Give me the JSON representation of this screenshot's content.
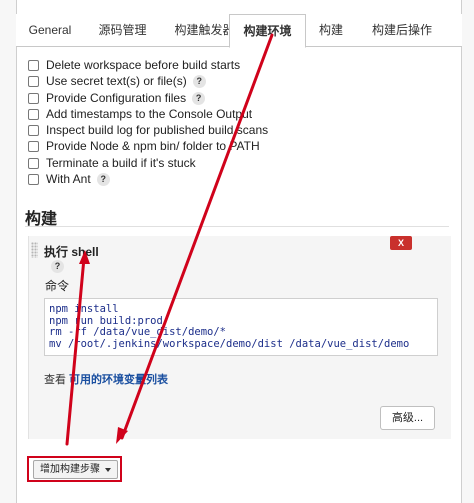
{
  "tabs": [
    {
      "label": "General"
    },
    {
      "label": "源码管理"
    },
    {
      "label": "构建触发器"
    },
    {
      "label": "构建环境"
    },
    {
      "label": "构建"
    },
    {
      "label": "构建后操作"
    }
  ],
  "active_tab": "构建环境",
  "build_env_options": [
    {
      "label": "Delete workspace before build starts",
      "checked": false,
      "help": false
    },
    {
      "label": "Use secret text(s) or file(s)",
      "checked": false,
      "help": true
    },
    {
      "label": "Provide Configuration files",
      "checked": false,
      "help": true
    },
    {
      "label": "Add timestamps to the Console Output",
      "checked": false,
      "help": false
    },
    {
      "label": "Inspect build log for published build scans",
      "checked": false,
      "help": false
    },
    {
      "label": "Provide Node & npm bin/ folder to PATH",
      "checked": false,
      "help": false
    },
    {
      "label": "Terminate a build if it's stuck",
      "checked": false,
      "help": false
    },
    {
      "label": "With Ant",
      "checked": false,
      "help": true
    }
  ],
  "help_glyph": "?",
  "build_section": {
    "title": "构建",
    "step": {
      "title": "执行 shell",
      "delete_label": "X",
      "command_label": "命令",
      "command": "npm install\nnpm run build:prod\nrm -rf /data/vue_dist/demo/*\nmv /root/.jenkins/workspace/demo/dist /data/vue_dist/demo",
      "env_prefix": "查看",
      "env_link": "可用的环境变量列表",
      "advanced_label": "高级..."
    },
    "add_step_label": "增加构建步骤"
  },
  "colors": {
    "annotation": "#d0021b",
    "delete_button": "#c9302c",
    "link": "#1a4fa0"
  }
}
